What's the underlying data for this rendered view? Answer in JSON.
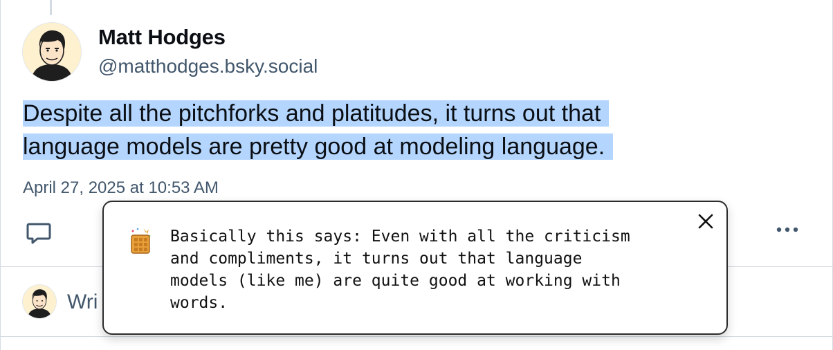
{
  "post": {
    "author_name": "Matt Hodges",
    "author_handle": "@matthodges.bsky.social",
    "text_lines": [
      "Despite all the pitchforks and platitudes, it turns out that",
      "language models are pretty good at modeling language."
    ],
    "timestamp": "April 27, 2025 at 10:53 AM",
    "selection_color": "#b4d5fd"
  },
  "actions": {
    "reply_icon": "reply-icon",
    "more_icon": "more-options-icon",
    "icon_color": "#42576c"
  },
  "reply_box": {
    "placeholder_visible": "Wri"
  },
  "explanation_popup": {
    "icon": "waffle-party-emoji",
    "lines": [
      "Basically this says: Even with all the criticism",
      "and compliments, it turns out that language",
      "models (like me) are quite good at working with",
      "words."
    ],
    "close_icon": "close-icon"
  }
}
